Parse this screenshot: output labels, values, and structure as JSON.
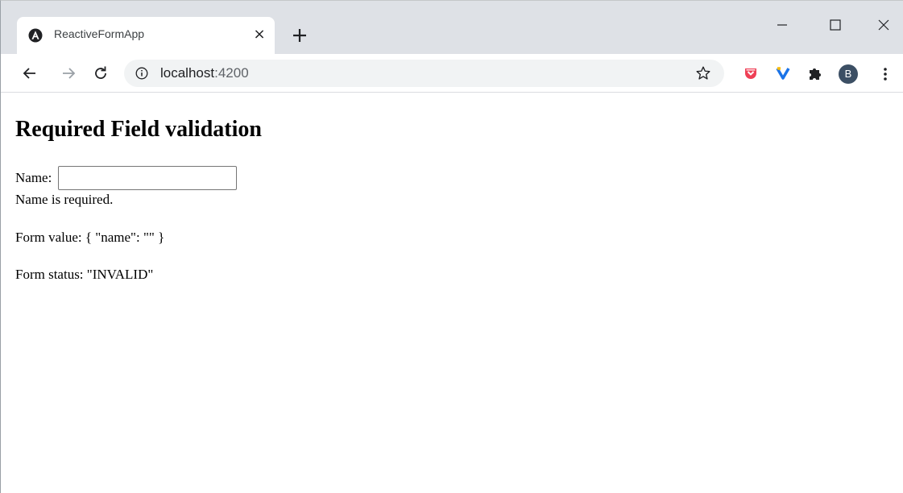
{
  "browser": {
    "tab": {
      "title": "ReactiveFormApp",
      "close": "×",
      "favicon": "angular-logo-icon"
    },
    "new_tab_icon": "plus-icon",
    "window_controls": [
      "minimize-icon",
      "maximize-icon",
      "close-icon"
    ],
    "nav": [
      "back-arrow-icon",
      "forward-arrow-icon",
      "reload-icon"
    ],
    "url": {
      "host": "localhost",
      "port": ":4200"
    },
    "bookmark_icon": "star-icon",
    "extensions": [
      "pocket-icon",
      "vee-extension-icon",
      "puzzle-icon"
    ],
    "profile_initial": "B",
    "menu_icon": "kebab-menu-icon",
    "colors": {
      "tabstrip": "#dee1e6",
      "omnibox": "#f1f3f4",
      "avatar": "#3c4f64",
      "pocket": "#ef4056",
      "vee": "#1a73e8"
    }
  },
  "page": {
    "title": "Required Field validation",
    "name_label": "Name:",
    "name_value": "",
    "error": "Name is required.",
    "form_value": "Form value: { \"name\": \"\" }",
    "form_status": "Form status: \"INVALID\""
  }
}
